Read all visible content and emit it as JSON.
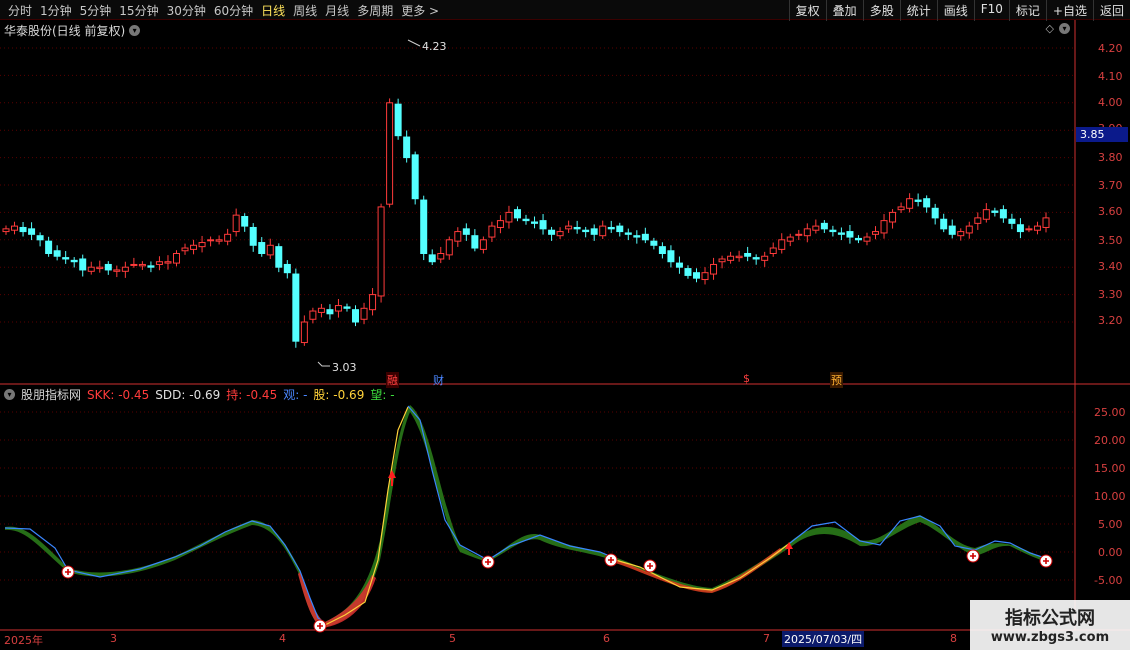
{
  "toolbar": {
    "periods": [
      "分时",
      "1分钟",
      "5分钟",
      "15分钟",
      "30分钟",
      "60分钟",
      "日线",
      "周线",
      "月线",
      "多周期",
      "更多 >"
    ],
    "active_period": "日线",
    "right_buttons": [
      "复权",
      "叠加",
      "多股",
      "统计",
      "画线",
      "F10",
      "标记",
      "+自选",
      "返回"
    ]
  },
  "stock": {
    "title": "华泰股份(日线 前复权)"
  },
  "price_axis": {
    "labels": [
      "4.20",
      "4.10",
      "4.00",
      "3.90",
      "3.80",
      "3.70",
      "3.60",
      "3.50",
      "3.40",
      "3.30",
      "3.20"
    ],
    "current": "3.85"
  },
  "annotations": {
    "high": "4.23",
    "low": "3.03"
  },
  "event_tags": [
    "融",
    "财",
    "$",
    "预"
  ],
  "indicator": {
    "name": "股朋指标网",
    "fields": [
      {
        "label": "SKK: -0.45",
        "color": "#ff3b3b"
      },
      {
        "label": "SDD: -0.69",
        "color": "#e0e0e0"
      },
      {
        "label": "持: -0.45",
        "color": "#ff3b3b"
      },
      {
        "label": "观: -",
        "color": "#4a86ff"
      },
      {
        "label": "股: -0.69",
        "color": "#ffd23a"
      },
      {
        "label": "望: -",
        "color": "#3ddc3d"
      }
    ],
    "axis_labels": [
      "25.00",
      "20.00",
      "15.00",
      "10.00",
      "5.00",
      "0.00",
      "-5.00"
    ]
  },
  "time_axis": {
    "labels": [
      "2025年",
      "3",
      "4",
      "5",
      "6",
      "7",
      "8"
    ],
    "highlight": "2025/07/03/四"
  },
  "watermark": {
    "title": "指标公式网",
    "url": "www.zbgs3.com"
  },
  "colors": {
    "up": "#ff3b3b",
    "down": "#54ffff",
    "grid": "#5a0000",
    "axis": "#d03030"
  },
  "chart_data": {
    "type": "candlestick",
    "title": "华泰股份(日线 前复权)",
    "ylim": [
      3.1,
      4.25
    ],
    "close": [
      3.54,
      3.55,
      3.53,
      3.52,
      3.5,
      3.45,
      3.44,
      3.43,
      3.42,
      3.39,
      3.4,
      3.4,
      3.39,
      3.39,
      3.4,
      3.41,
      3.41,
      3.4,
      3.42,
      3.42,
      3.45,
      3.47,
      3.48,
      3.49,
      3.5,
      3.5,
      3.52,
      3.59,
      3.55,
      3.48,
      3.45,
      3.48,
      3.4,
      3.38,
      3.13,
      3.2,
      3.24,
      3.25,
      3.23,
      3.26,
      3.25,
      3.2,
      3.25,
      3.3,
      3.62,
      4.0,
      3.88,
      3.8,
      3.65,
      3.45,
      3.42,
      3.45,
      3.5,
      3.53,
      3.52,
      3.47,
      3.5,
      3.55,
      3.57,
      3.6,
      3.58,
      3.57,
      3.56,
      3.54,
      3.52,
      3.53,
      3.55,
      3.54,
      3.53,
      3.52,
      3.55,
      3.54,
      3.53,
      3.52,
      3.51,
      3.5,
      3.48,
      3.45,
      3.42,
      3.4,
      3.37,
      3.36,
      3.38,
      3.41,
      3.43,
      3.44,
      3.44,
      3.44,
      3.43,
      3.44,
      3.47,
      3.5,
      3.51,
      3.52,
      3.54,
      3.55,
      3.54,
      3.53,
      3.52,
      3.51,
      3.5,
      3.51,
      3.53,
      3.57,
      3.6,
      3.62,
      3.65,
      3.64,
      3.62,
      3.58,
      3.54,
      3.52,
      3.53,
      3.55,
      3.58,
      3.61,
      3.6,
      3.58,
      3.56,
      3.53,
      3.54,
      3.55,
      3.58
    ]
  }
}
